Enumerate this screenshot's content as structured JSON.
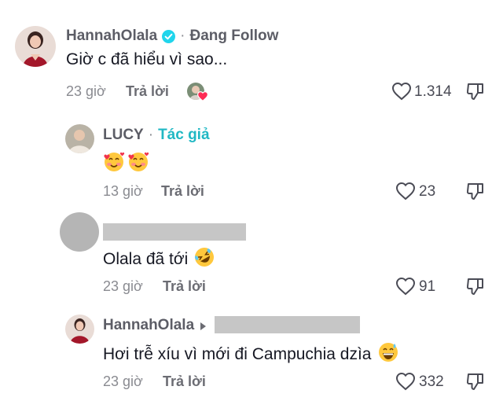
{
  "comments": [
    {
      "username": "HannahOlala",
      "badge_icon": "verified-badge-icon",
      "separator": "·",
      "follow_status": "Đang Follow",
      "text": "Giờ c đã hiểu vì sao...",
      "time": "23 giờ",
      "reply_label": "Trả lời",
      "likes": "1.314"
    },
    {
      "username": "LUCY",
      "separator": "·",
      "author_tag": "Tác giả",
      "emojis": [
        "smiling-face-with-hearts",
        "smiling-face-with-hearts"
      ],
      "time": "13 giờ",
      "reply_label": "Trả lời",
      "likes": "23"
    },
    {
      "username_hidden": true,
      "text": "Olala đã tới",
      "emoji": "rolling-on-floor-laughing",
      "time": "23 giờ",
      "reply_label": "Trả lời",
      "likes": "91"
    },
    {
      "username": "HannahOlala",
      "reply_arrow_icon": "caret-right-icon",
      "text": "Hơi trễ xíu vì mới đi Campuchia dzìa",
      "emoji": "grinning-face-with-sweat",
      "time": "23 giờ",
      "reply_label": "Trả lời",
      "likes": "332"
    }
  ],
  "colors": {
    "author_tag": "#20b8c4",
    "verified": "#20d5ec",
    "heart_badge": "#fe2c55",
    "redaction": "#c6c6c6"
  }
}
